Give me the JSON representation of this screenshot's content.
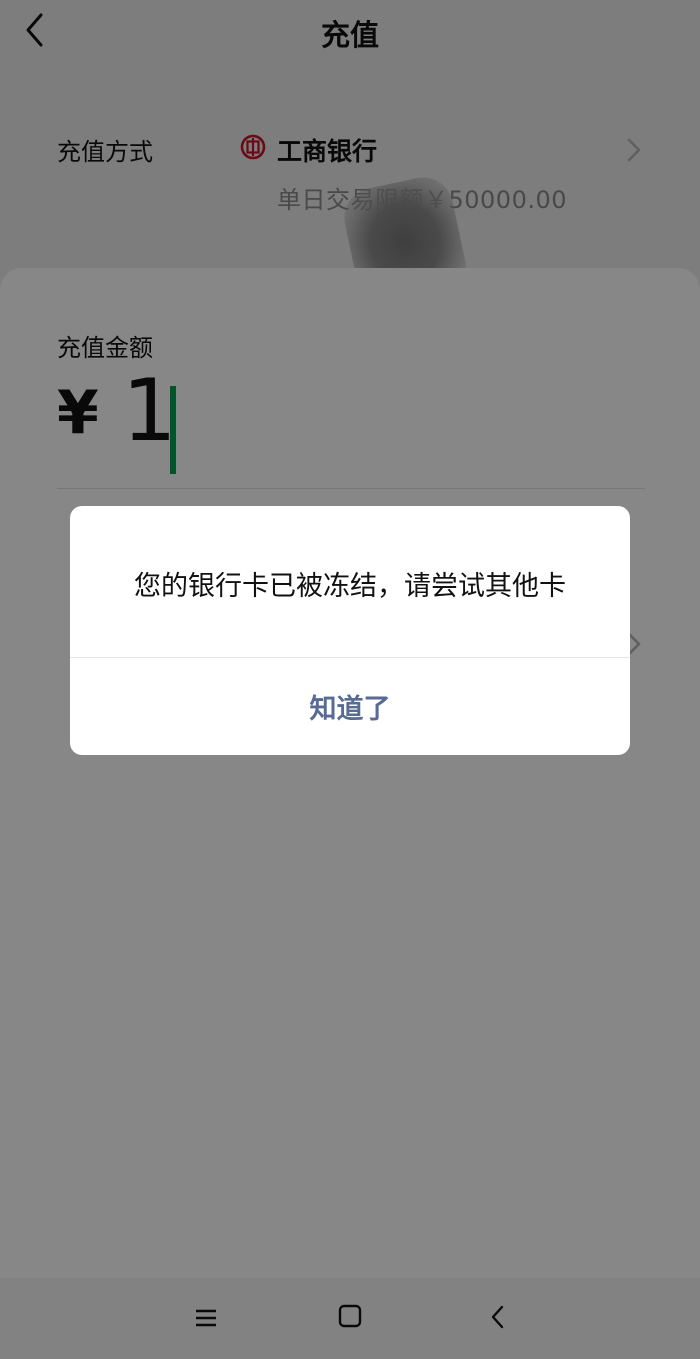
{
  "nav": {
    "title": "充值",
    "back_icon": "chevron-left-icon"
  },
  "payment_method": {
    "label": "充值方式",
    "bank_icon": "icbc-logo-icon",
    "bank_name": "工商银行",
    "limit_text": "单日交易限额￥50000.00",
    "chevron_icon": "chevron-right-icon"
  },
  "amount": {
    "label": "充值金额",
    "currency_symbol": "¥",
    "value": "1"
  },
  "dialog": {
    "message": "您的银行卡已被冻结，请尝试其他卡",
    "confirm_label": "知道了"
  },
  "system_nav": {
    "menu_icon": "menu-icon",
    "home_icon": "home-square-icon",
    "back_icon": "back-arrow-icon"
  },
  "colors": {
    "accent_cursor": "#07a04e",
    "dialog_button": "#576b95",
    "bank_red": "#c7162b"
  }
}
